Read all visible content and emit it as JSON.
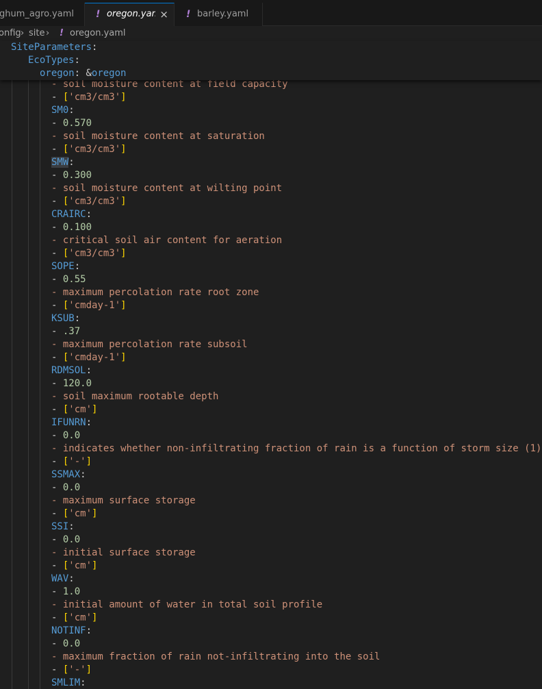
{
  "tabs": [
    {
      "label": "ghum_agro.yaml",
      "active": false,
      "has_bang": false
    },
    {
      "label": "oregon.yaml",
      "active": true,
      "has_bang": true
    },
    {
      "label": "barley.yaml",
      "active": false,
      "has_bang": true
    }
  ],
  "tab_close_glyph": "×",
  "yaml_glyph": "!",
  "breadcrumb": {
    "items": [
      "onfig",
      "site",
      "oregon.yaml"
    ],
    "separator": "›"
  },
  "sticky": {
    "line1_key": "SiteParameters",
    "line2_key": "EcoTypes",
    "line3_key": "oregon",
    "line3_anchor_amp": "&",
    "line3_anchor_name": "oregon"
  },
  "colors": {
    "key": "#569cd6",
    "string": "#ce9178",
    "number": "#b5cea8",
    "bracket": "#ffd700",
    "yaml_icon": "#b180d7",
    "editor_bg": "#1f1f1f"
  },
  "parameters": [
    {
      "name": "SM0",
      "value": "0.570",
      "description": "soil moisture content at saturation",
      "unit": "'cm3/cm3'"
    },
    {
      "name": "SMW",
      "value": "0.300",
      "description": "soil moisture content at wilting point",
      "unit": "'cm3/cm3'"
    },
    {
      "name": "CRAIRC",
      "value": "0.100",
      "description": "critical soil air content for aeration",
      "unit": "'cm3/cm3'"
    },
    {
      "name": "SOPE",
      "value": "0.55",
      "description": "maximum percolation rate root zone",
      "unit": "'cmday-1'"
    },
    {
      "name": "KSUB",
      "value": ".37",
      "description": "maximum percolation rate subsoil",
      "unit": "'cmday-1'"
    },
    {
      "name": "RDMSOL",
      "value": "120.0",
      "description": "soil maximum rootable depth",
      "unit": "'cm'"
    },
    {
      "name": "IFUNRN",
      "value": "0.0",
      "description": "indicates whether non-infiltrating fraction of rain is a function of storm size (1)",
      "unit": "'-'"
    },
    {
      "name": "SSMAX",
      "value": "0.0",
      "description": "maximum surface storage",
      "unit": "'cm'"
    },
    {
      "name": "SSI",
      "value": "0.0",
      "description": "initial surface storage",
      "unit": "'cm'"
    },
    {
      "name": "WAV",
      "value": "1.0",
      "description": "initial amount of water in total soil profile",
      "unit": "'cm'"
    },
    {
      "name": "NOTINF",
      "value": "0.0",
      "description": "maximum fraction of rain not-infiltrating into the soil",
      "unit": "'-'"
    }
  ],
  "partial_top": {
    "description": "soil moisture content at field capacity",
    "unit": "'cm3/cm3'"
  },
  "partial_bottom": {
    "name": "SMLIM"
  },
  "dash": "- ",
  "colon": ":"
}
